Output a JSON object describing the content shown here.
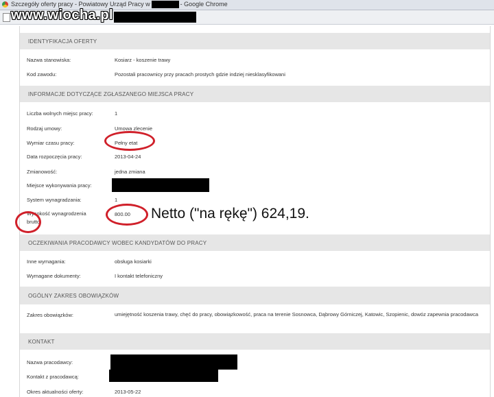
{
  "window": {
    "title_prefix": "Szczegóły oferty pracy - Powiatowy Urząd Pracy w",
    "title_suffix": "Google Chrome"
  },
  "watermark": "www.wiocha.pl",
  "sections": {
    "identyfikacja": "IDENTYFIKACJA OFERTY",
    "informacje": "INFORMACJE DOTYCZĄCE ZGŁASZANEGO MIEJSCA PRACY",
    "oczekiwania": "OCZEKIWANIA PRACODAWCY WOBEC KANDYDATÓW DO PRACY",
    "zakres": "OGÓLNY ZAKRES OBOWIĄZKÓW",
    "kontakt": "KONTAKT"
  },
  "fields": {
    "nazwa_stanowiska": {
      "label": "Nazwa stanowiska:",
      "value": "Kosiarz - koszenie trawy"
    },
    "kod_zawodu": {
      "label": "Kod zawodu:",
      "value": "Pozostali pracownicy przy pracach prostych gdzie indziej niesklasyfikowani"
    },
    "liczba_miejsc": {
      "label": "Liczba wolnych miejsc pracy:",
      "value": "1"
    },
    "rodzaj_umowy": {
      "label": "Rodzaj umowy:",
      "value": "Umowa zlecenie"
    },
    "wymiar": {
      "label": "Wymiar czasu pracy:",
      "value": "Pełny etat"
    },
    "data_rozpoczecia": {
      "label": "Data rozpoczęcia pracy:",
      "value": "2013-04-24"
    },
    "zmianowosc": {
      "label": "Zmianowość:",
      "value": "jedna zmiana"
    },
    "miejsce": {
      "label": "Miejsce wykonywania pracy:",
      "value": ""
    },
    "system": {
      "label": "System wynagradzania:",
      "value": "1"
    },
    "wynagrodzenie": {
      "label": "Wysokość wynagrodzenia brutto:",
      "value": "800.00"
    },
    "inne_wymagania": {
      "label": "Inne wymagania:",
      "value": "obsługa kosiarki"
    },
    "dokumenty": {
      "label": "Wymagane dokumenty:",
      "value": "I kontakt telefoniczny"
    },
    "zakres": {
      "label": "Zakres obowiązków:",
      "value": "umiejętność koszenia trawy, chęć do pracy, obowiązkowość, praca na terenie Sosnowca, Dąbrowy Górniczej, Katowic, Szopienic, dowóz zapewnia pracodawca"
    },
    "nazwa_pracodawcy": {
      "label": "Nazwa pracodawcy:",
      "value": ""
    },
    "kontakt_pracodawca": {
      "label": "Kontakt z pracodawcą:",
      "value": ""
    },
    "okres": {
      "label": "Okres aktualności oferty:",
      "value": "2013-05-22"
    }
  },
  "annotation": "Netto (\"na rękę\") 624,19.",
  "colors": {
    "highlight": "#d0202a",
    "section_bg": "#e6e6e6"
  }
}
